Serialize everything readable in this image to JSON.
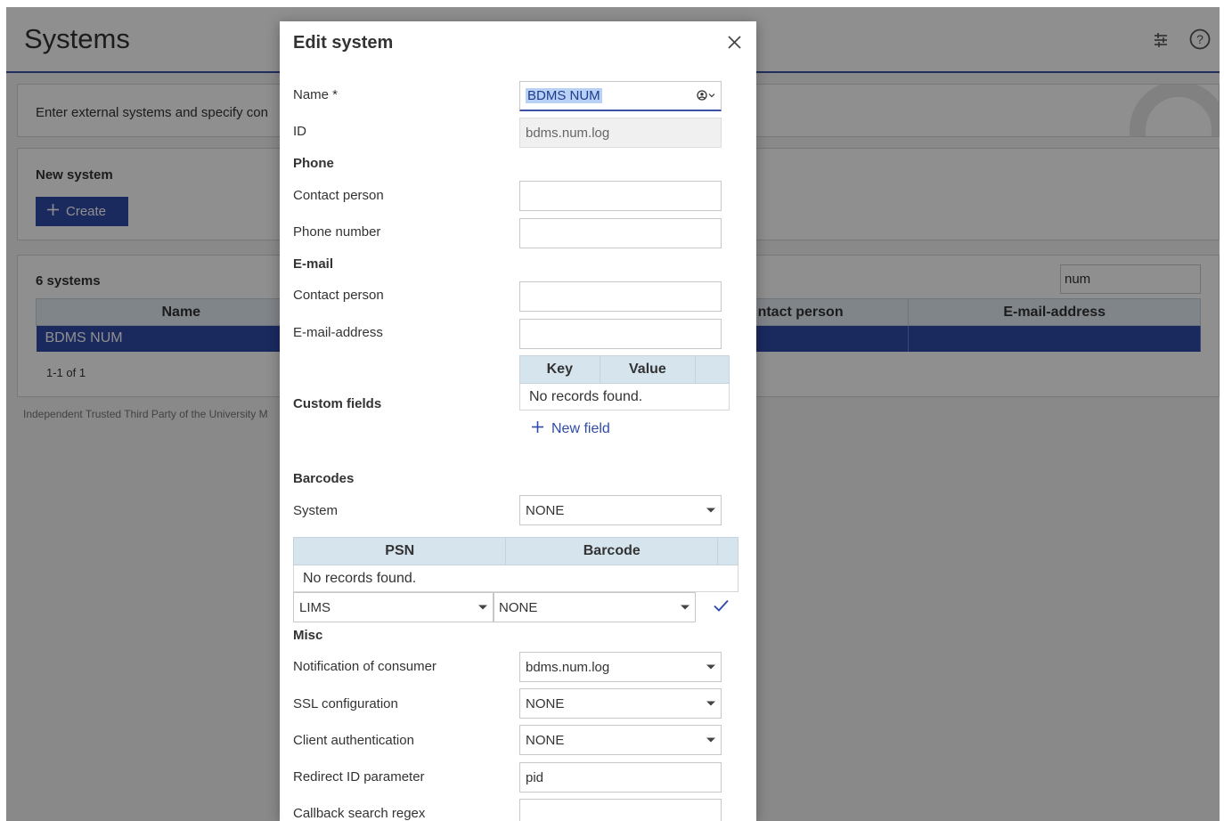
{
  "page": {
    "title": "Systems",
    "intro": "Enter external systems and specify con",
    "new_system": {
      "title": "New system",
      "create_label": "Create"
    },
    "list": {
      "count_label": "6 systems",
      "filter_value": "num",
      "columns": [
        "Name",
        "ntact person",
        "E-mail-address"
      ],
      "rows": [
        {
          "name": "BDMS NUM",
          "contact": "",
          "email": ""
        }
      ],
      "paginator": "1-1 of 1"
    },
    "footer": "Independent Trusted Third Party of the University M"
  },
  "dialog": {
    "title": "Edit system",
    "name": {
      "label": "Name *",
      "value": "BDMS NUM"
    },
    "id": {
      "label": "ID",
      "value": "bdms.num.log"
    },
    "phone": {
      "section": "Phone",
      "contact_label": "Contact person",
      "contact_value": "",
      "number_label": "Phone number",
      "number_value": ""
    },
    "email": {
      "section": "E-mail",
      "contact_label": "Contact person",
      "contact_value": "",
      "address_label": "E-mail-address",
      "address_value": ""
    },
    "custom_fields": {
      "label": "Custom fields",
      "columns": [
        "Key",
        "Value"
      ],
      "empty": "No records found.",
      "new_field_label": "New field"
    },
    "barcodes": {
      "section": "Barcodes",
      "system_label": "System",
      "system_value": "NONE",
      "columns": [
        "PSN",
        "Barcode"
      ],
      "empty": "No records found.",
      "psn_select": "LIMS",
      "barcode_select": "NONE"
    },
    "misc": {
      "section": "Misc",
      "notification_label": "Notification of consumer",
      "notification_value": "bdms.num.log",
      "ssl_label": "SSL configuration",
      "ssl_value": "NONE",
      "client_auth_label": "Client authentication",
      "client_auth_value": "NONE",
      "redirect_label": "Redirect ID parameter",
      "redirect_value": "pid",
      "callback_label": "Callback search regex",
      "callback_value": ""
    }
  },
  "colors": {
    "primary": "#2f4aa8",
    "table_header": "#d6e4ee",
    "overlay": "rgba(0,0,0,0.44)"
  }
}
